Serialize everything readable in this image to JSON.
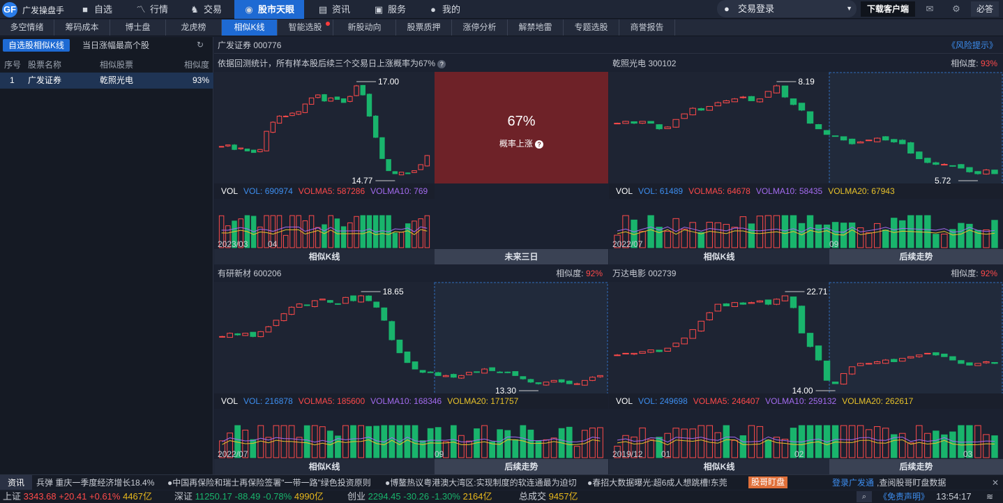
{
  "app": {
    "logo": "GF",
    "name": "广发操盘手"
  },
  "nav": [
    {
      "icon": "■",
      "label": "自选"
    },
    {
      "icon": "〽",
      "label": "行情"
    },
    {
      "icon": "♞",
      "label": "交易"
    },
    {
      "icon": "◉",
      "label": "股市天眼"
    },
    {
      "icon": "▤",
      "label": "资讯"
    },
    {
      "icon": "▣",
      "label": "服务"
    },
    {
      "icon": "●",
      "label": "我的"
    }
  ],
  "topright": {
    "login": "交易登录",
    "download": "下载客户端",
    "must": "必答"
  },
  "subtabs": [
    "多空情绪",
    "筹码成本",
    "博士盘",
    "龙虎榜",
    "相似K线",
    "智能选股",
    "新股动向",
    "股票质押",
    "涨停分析",
    "解禁地雷",
    "专题选股",
    "商誉报告"
  ],
  "left": {
    "tabs": [
      "自选股相似K线",
      "当日涨幅最高个股"
    ],
    "headers": [
      "序号",
      "股票名称",
      "相似股票",
      "相似度"
    ],
    "row": {
      "no": "1",
      "name": "广发证券",
      "similar": "乾照光电",
      "score": "93%"
    }
  },
  "main": {
    "stock": "广发证券 000776",
    "risk": "《风险提示》"
  },
  "panels": {
    "p1": {
      "title": "依据回测统计，所有样本股后续三个交易日上涨概率为67%",
      "help": "?",
      "prob": "67%",
      "prob_label": "概率上涨",
      "high": "17.00",
      "low": "14.77",
      "vol": "VOL",
      "vol_val": "VOL: 690974",
      "ma5": "VOLMA5: 587286",
      "ma10": "VOLMA10: 769",
      "x1": "2023/03",
      "x2": "04",
      "bot1": "相似K线",
      "bot2": "未来三日"
    },
    "p2": {
      "title": "乾照光电 300102",
      "sim_label": "相似度:",
      "sim": "93%",
      "high": "8.19",
      "low": "5.72",
      "vol": "VOL",
      "vol_val": "VOL: 61489",
      "ma5": "VOLMA5: 64678",
      "ma10": "VOLMA10: 58435",
      "ma20": "VOLMA20: 67943",
      "x1": "2022/07",
      "x2": "09",
      "bot1": "相似K线",
      "bot2": "后续走势"
    },
    "p3": {
      "title": "有研新材 600206",
      "sim_label": "相似度:",
      "sim": "92%",
      "high": "18.65",
      "low": "13.30",
      "vol": "VOL",
      "vol_val": "VOL: 216878",
      "ma5": "VOLMA5: 185600",
      "ma10": "VOLMA10: 168346",
      "ma20": "VOLMA20: 171757",
      "x1": "2022/07",
      "x2": "09",
      "bot1": "相似K线",
      "bot2": "后续走势"
    },
    "p4": {
      "title": "万达电影 002739",
      "sim_label": "相似度:",
      "sim": "92%",
      "high": "22.71",
      "low": "14.00",
      "vol": "VOL",
      "vol_val": "VOL: 249698",
      "ma5": "VOLMA5: 246407",
      "ma10": "VOLMA10: 259132",
      "ma20": "VOLMA20: 262617",
      "x1": "2019/12",
      "x2": "01",
      "x3": "02",
      "x4": "03",
      "bot1": "相似K线",
      "bot2": "后续走势"
    }
  },
  "ticker": {
    "label": "资讯",
    "items": [
      "兵弹 重庆一季度经济增长18.4%",
      "●中国再保险和瑞士再保险签署\"一带一路\"绿色投资原则",
      "●博鳌热议粤港澳大湾区:实现制度的软连通最为迫切",
      "●春招大数据曝光:超6成人想跳槽!东莞"
    ],
    "badge": "股哥盯盘",
    "link": "登录广发通",
    "link_rest": ",查阅股哥盯盘数据"
  },
  "index": {
    "sh": {
      "name": "上证",
      "val": "3343.68",
      "chg": "+20.41",
      "pct": "+0.61%",
      "amt": "4467亿"
    },
    "sz": {
      "name": "深证",
      "val": "11250.17",
      "chg": "-88.49",
      "pct": "-0.78%",
      "amt": "4990亿"
    },
    "cy": {
      "name": "创业",
      "val": "2294.45",
      "chg": "-30.26",
      "pct": "-1.30%",
      "amt": "2164亿"
    },
    "total_label": "总成交",
    "total": "9457亿",
    "disclaimer": "《免责声明》",
    "time": "13:54:17"
  }
}
